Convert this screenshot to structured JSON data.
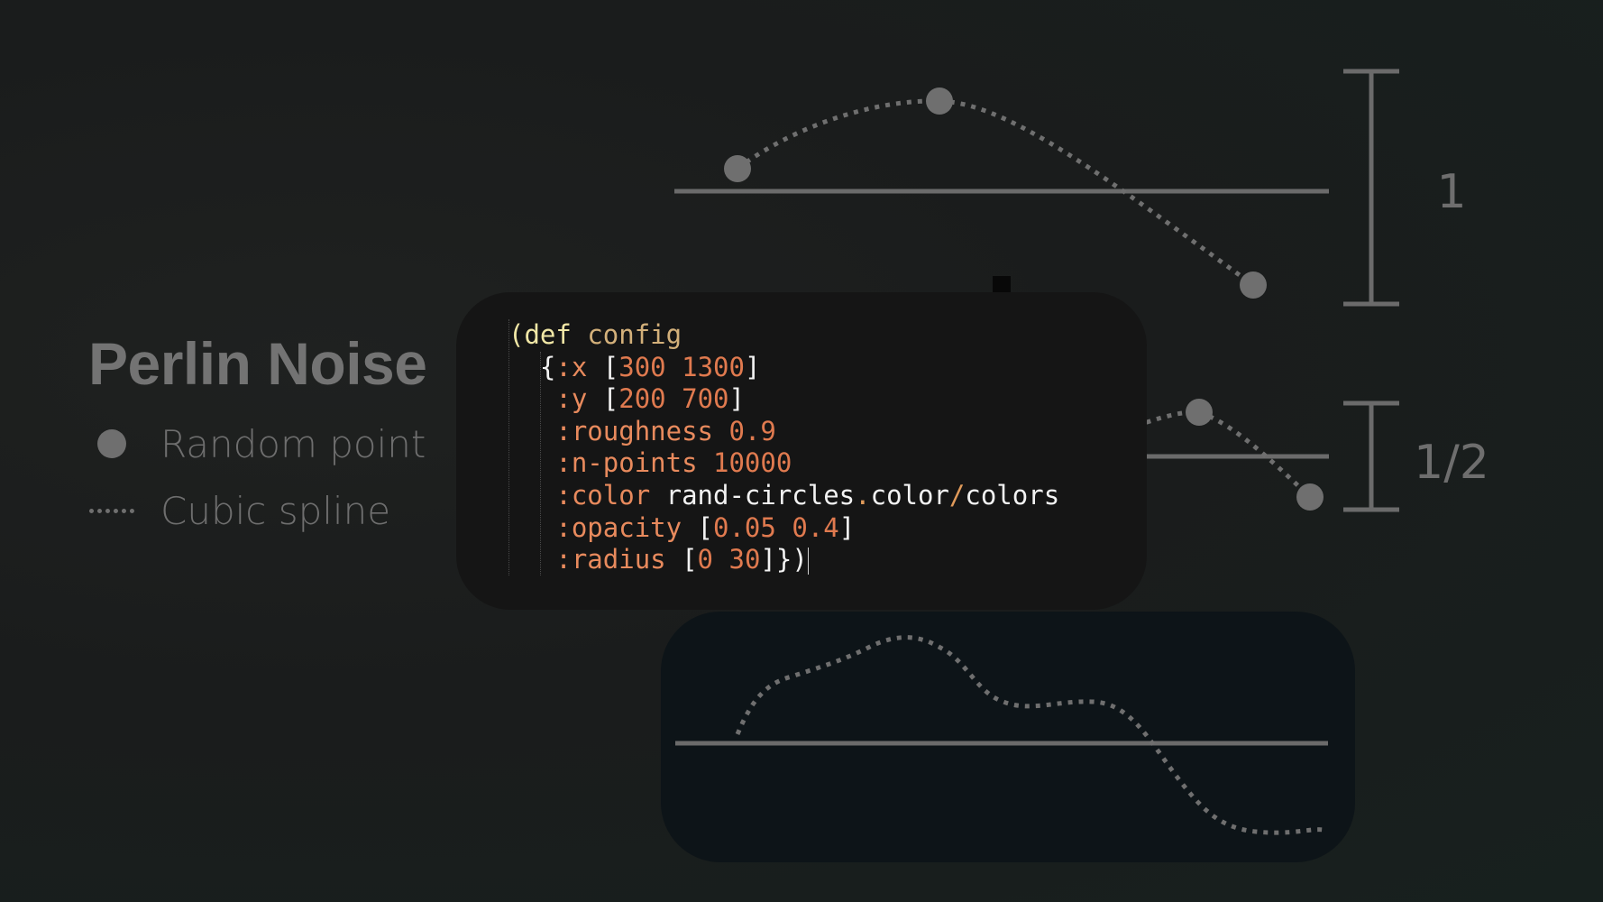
{
  "legend": {
    "title": "Perlin Noise",
    "items": [
      {
        "label": "Random point",
        "icon": "dot-icon"
      },
      {
        "label": "Cubic spline",
        "icon": "dotted-line-icon"
      }
    ]
  },
  "scales": {
    "top_label": "1",
    "mid_label": "1/2"
  },
  "code": {
    "line1": {
      "open": "(",
      "def": "def",
      "name": "config"
    },
    "line2": {
      "brace": "{",
      "key": ":x",
      "lb": "[",
      "v1": "300",
      "v2": "1300",
      "rb": "]"
    },
    "line3": {
      "key": ":y",
      "lb": "[",
      "v1": "200",
      "v2": "700",
      "rb": "]"
    },
    "line4": {
      "key": ":roughness",
      "v1": "0.9"
    },
    "line5": {
      "key": ":n-points",
      "v1": "10000"
    },
    "line6": {
      "key": ":color",
      "ns": "rand-circles",
      "dot": ".",
      "mid": "color",
      "slash": "/",
      "sym": "colors"
    },
    "line7": {
      "key": ":opacity",
      "lb": "[",
      "v1": "0.05",
      "v2": "0.4",
      "rb": "]"
    },
    "line8": {
      "key": ":radius",
      "lb": "[",
      "v1": "0",
      "v2": "30",
      "close": "]})"
    }
  },
  "colors": {
    "background": "#1a1c1c",
    "axis": "#6b6b6b",
    "point": "#6f6f6f",
    "code_panel": "#151515",
    "noise_panel": "#0d1418",
    "keyword": "#e88a5d",
    "number": "#e07a4f"
  }
}
